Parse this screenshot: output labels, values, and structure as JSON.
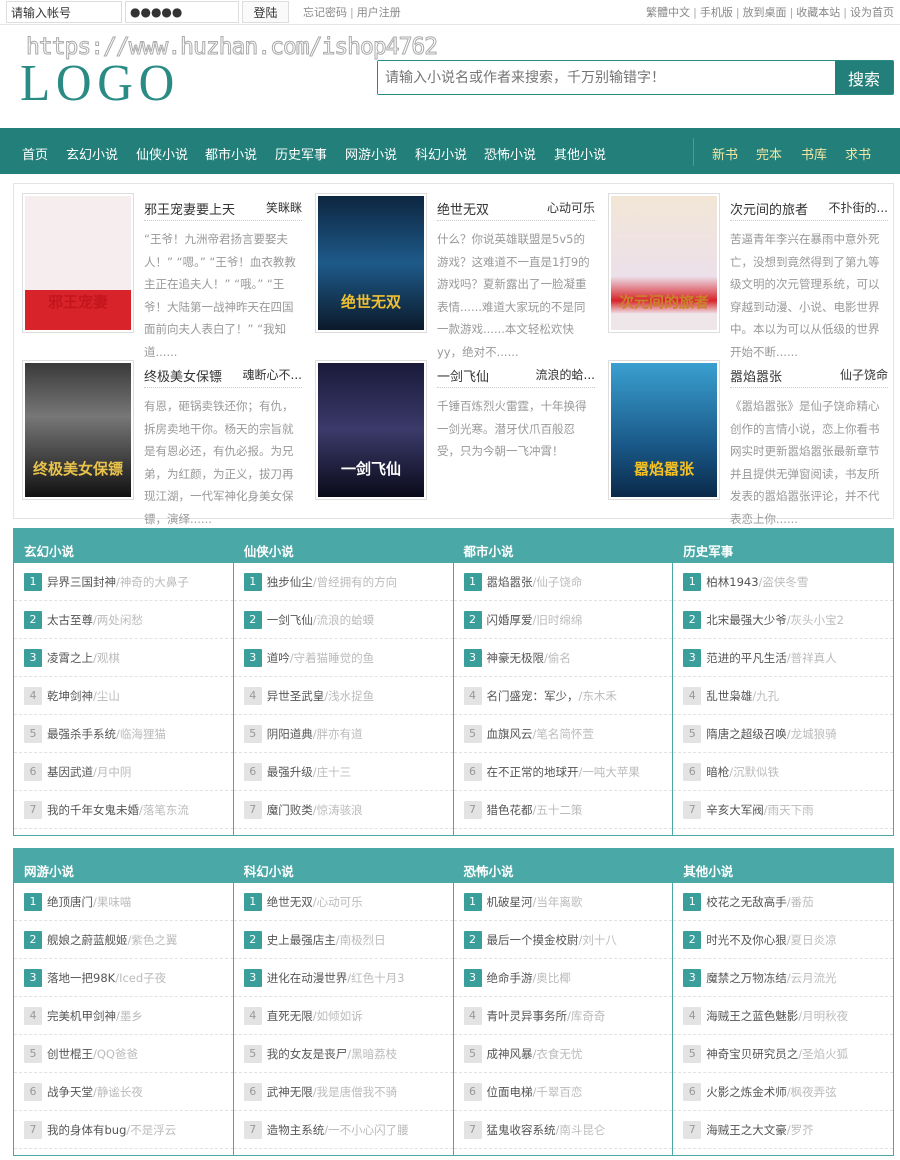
{
  "topbar": {
    "account_value": "请输入帐号",
    "password_value": "●●●●●",
    "login_label": "登陆",
    "forgot_label": "忘记密码",
    "register_label": "用户注册",
    "right_links": [
      "繁體中文",
      "手机版",
      "放到桌面",
      "收藏本站",
      "设为首页"
    ]
  },
  "header": {
    "watermark": "https://www.huzhan.com/ishop4762",
    "logo": "LOGO",
    "search_placeholder": "请输入小说名或作者来搜索，千万别输错字！",
    "search_label": "搜索"
  },
  "nav": {
    "items": [
      "首页",
      "玄幻小说",
      "仙侠小说",
      "都市小说",
      "历史军事",
      "网游小说",
      "科幻小说",
      "恐怖小说",
      "其他小说"
    ],
    "right_items": [
      "新书",
      "完本",
      "书库",
      "求书"
    ]
  },
  "colors": {
    "primary": "#237f79",
    "panel": "#4aa8a6",
    "nav_right": "#f3e7a6"
  },
  "featured": [
    {
      "title": "邪王宠妻要上天",
      "author": "笑眯眯",
      "desc": "“王爷！九洲帝君扬言要娶夫人！” “嗯。” “王爷！血衣教教主正在追夫人！” “哦。” “王爷！大陆第一战神昨天在四国面前向夫人表白了！” “我知道......",
      "cover_text": "邪王宠妻",
      "cover_bg": "linear-gradient(#f6eeee 70%,#d8232a 70%)",
      "cover_fg": "#c4151c"
    },
    {
      "title": "绝世无双",
      "author": "心动可乐",
      "desc": "什么？你说英雄联盟是5v5的游戏？这难道不一直是1打9的游戏吗？夏新露出了一脸凝重表情......难道大家玩的不是同一款游戏......本文轻松欢快yy，绝对不......",
      "cover_text": "绝世无双",
      "cover_bg": "linear-gradient(#0d2640,#1e5a8a 50%,#0b1a2a)",
      "cover_fg": "#f0c030"
    },
    {
      "title": "次元间的旅者",
      "author": "不扑街的...",
      "desc": "苦逼青年李兴在暴雨中意外死亡，没想到竟然得到了第九等级文明的次元管理系统，可以穿越到动漫、小说、电影世界中。本以为可以从低级的世界开始不断......",
      "cover_text": "次元间的旅者",
      "cover_bg": "linear-gradient(#f3e6d6,#ece0ea 60%,#d8232a 78%,#efe6ea 88%)",
      "cover_fg": "#c8822a"
    },
    {
      "title": "终极美女保镖",
      "author": "魂断心不...",
      "desc": "有恩，砸锅卖铁还你；有仇，拆房卖地干你。杨天的宗旨就是有恩必还，有仇必报。为兄弟，为红颜，为正义，拔刀再现江湖，一代军神化身美女保镖，演绎......",
      "cover_text": "终极美女保镖",
      "cover_bg": "linear-gradient(#3a3a3a,#777 40%,#111)",
      "cover_fg": "#e8c24a"
    },
    {
      "title": "一剑飞仙",
      "author": "流浪的蛤...",
      "desc": "千锤百炼烈火雷霆，十年换得一剑光寒。潜牙伏爪百般忍受，只为今朝一飞冲霄！",
      "cover_text": "一剑飞仙",
      "cover_bg": "linear-gradient(#1a1a3a,#3b3a6a 50%,#0a0a1a)",
      "cover_fg": "#ffffff"
    },
    {
      "title": "嚣焰嚣张",
      "author": "仙子饶命",
      "desc": "《嚣焰嚣张》是仙子饶命精心创作的言情小说，恋上你看书网实时更新嚣焰嚣张最新章节并且提供无弹窗阅读，书友所发表的嚣焰嚣张评论，并不代表恋上你......",
      "cover_text": "嚣焰嚣张",
      "cover_bg": "linear-gradient(#3aa0d0,#1a5a8a 60%,#0a2a4a)",
      "cover_fg": "#f5c020"
    }
  ],
  "panels": [
    {
      "title": "玄幻小说",
      "items": [
        [
          "异界三国封神",
          "神奇的大鼻子"
        ],
        [
          "太古至尊",
          "两处闲愁"
        ],
        [
          "凌霄之上",
          "观棋"
        ],
        [
          "乾坤剑神",
          "尘山"
        ],
        [
          "最强杀手系统",
          "临海狸猫"
        ],
        [
          "基因武道",
          "月中阴"
        ],
        [
          "我的千年女鬼未婚",
          "落笔东流"
        ]
      ]
    },
    {
      "title": "仙侠小说",
      "items": [
        [
          "独步仙尘",
          "曾经拥有的方向"
        ],
        [
          "一剑飞仙",
          "流浪的蛤蟆"
        ],
        [
          "道吟",
          "守着猫睡觉的鱼"
        ],
        [
          "异世圣武皇",
          "浅水捉鱼"
        ],
        [
          "阴阳道典",
          "胖亦有道"
        ],
        [
          "最强升级",
          "庄十三"
        ],
        [
          "魔门败类",
          "惊涛骇浪"
        ]
      ]
    },
    {
      "title": "都市小说",
      "items": [
        [
          "嚣焰嚣张",
          "仙子饶命"
        ],
        [
          "闪婚厚爱",
          "旧时绵绵"
        ],
        [
          "神豪无极限",
          "偷名"
        ],
        [
          "名门盛宠：军少，",
          "东木禾"
        ],
        [
          "血旗风云",
          "笔名简怀萱"
        ],
        [
          "在不正常的地球开",
          "一吨大苹果"
        ],
        [
          "猎色花都",
          "五十二策"
        ]
      ]
    },
    {
      "title": "历史军事",
      "items": [
        [
          "柏林1943",
          "盗侠冬雪"
        ],
        [
          "北宋最强大少爷",
          "灰头小宝2"
        ],
        [
          "范进的平凡生活",
          "普祥真人"
        ],
        [
          "乱世枭雄",
          "九孔"
        ],
        [
          "隋唐之超级召唤",
          "龙城狼骑"
        ],
        [
          "暗枪",
          "沉默似铁"
        ],
        [
          "辛亥大军阀",
          "雨天下雨"
        ]
      ]
    },
    {
      "title": "网游小说",
      "items": [
        [
          "绝顶唐门",
          "果味喵"
        ],
        [
          "舰娘之蔚蓝舰姬",
          "紫色之翼"
        ],
        [
          "落地一把98K",
          "Iced子夜"
        ],
        [
          "完美机甲剑神",
          "墨乡"
        ],
        [
          "创世棍王",
          "QQ爸爸"
        ],
        [
          "战争天堂",
          "静谧长夜"
        ],
        [
          "我的身体有bug",
          "不是浮云"
        ]
      ]
    },
    {
      "title": "科幻小说",
      "items": [
        [
          "绝世无双",
          "心动可乐"
        ],
        [
          "史上最强店主",
          "南极烈日"
        ],
        [
          "进化在动漫世界",
          "红色十月3"
        ],
        [
          "直死无限",
          "如倾如诉"
        ],
        [
          "我的女友是丧尸",
          "黑暗荔枝"
        ],
        [
          "武神无限",
          "我是唐僧我不骑"
        ],
        [
          "造物主系统",
          "一不小心闪了腰"
        ]
      ]
    },
    {
      "title": "恐怖小说",
      "items": [
        [
          "机破星河",
          "当年离歌"
        ],
        [
          "最后一个摸金校尉",
          "刘十八"
        ],
        [
          "绝命手游",
          "奥比椰"
        ],
        [
          "青叶灵异事务所",
          "库奇奇"
        ],
        [
          "成神风暴",
          "衣食无忧"
        ],
        [
          "位面电梯",
          "千翠百恋"
        ],
        [
          "猛鬼收容系统",
          "南斗昆仑"
        ]
      ]
    },
    {
      "title": "其他小说",
      "items": [
        [
          "校花之无敌高手",
          "番茄"
        ],
        [
          "时光不及你心狠",
          "夏日炎凉"
        ],
        [
          "魔禁之万物冻结",
          "云月流光"
        ],
        [
          "海贼王之蓝色魅影",
          "月明秋夜"
        ],
        [
          "神奇宝贝研究员之",
          "圣焰火狐"
        ],
        [
          "火影之炼金术师",
          "枫夜弄弦"
        ],
        [
          "海贼王之大文豪",
          "罗芥"
        ]
      ]
    }
  ]
}
